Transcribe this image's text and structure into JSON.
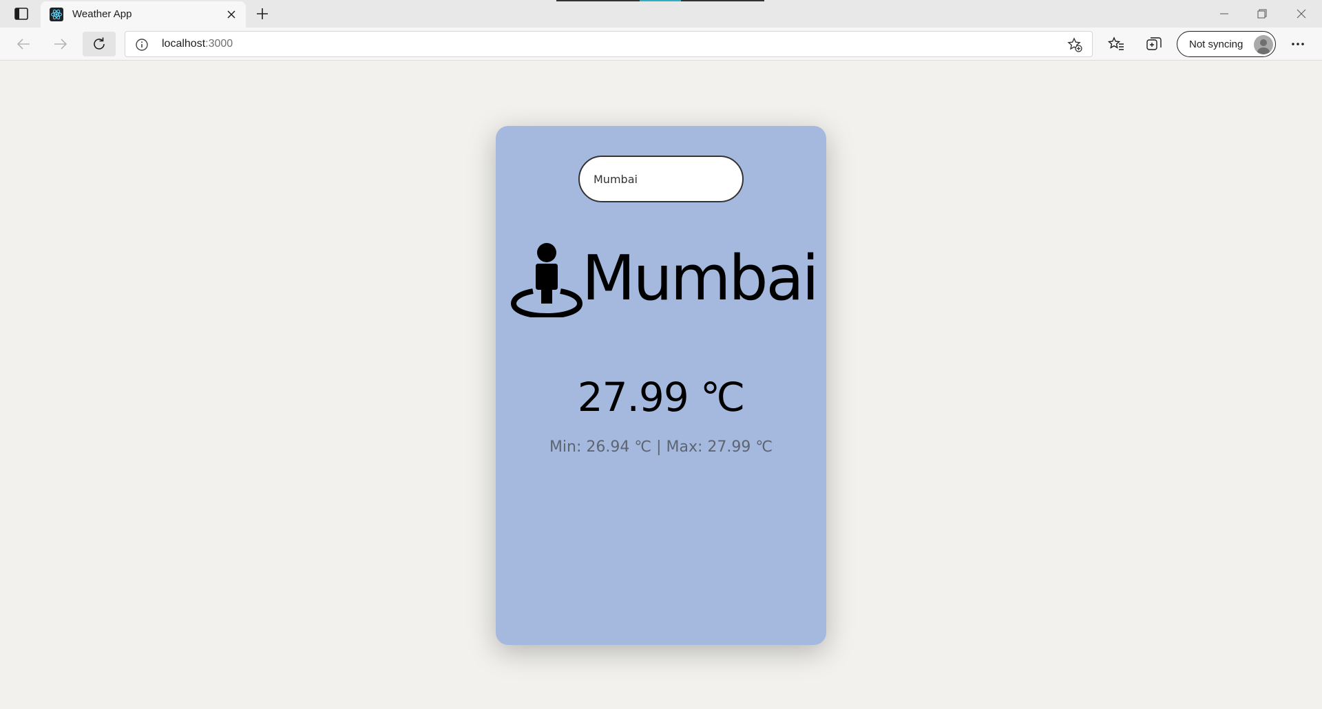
{
  "browser": {
    "tab_title": "Weather App",
    "address_host": "localhost",
    "address_port": ":3000",
    "sync_label": "Not syncing"
  },
  "app": {
    "search_value": "Mumbai",
    "city": "Mumbai",
    "temperature": "27.99 ℃",
    "min_max": "Min: 26.94 ℃ | Max: 27.99 ℃",
    "card_color": "#a4b9dd"
  }
}
